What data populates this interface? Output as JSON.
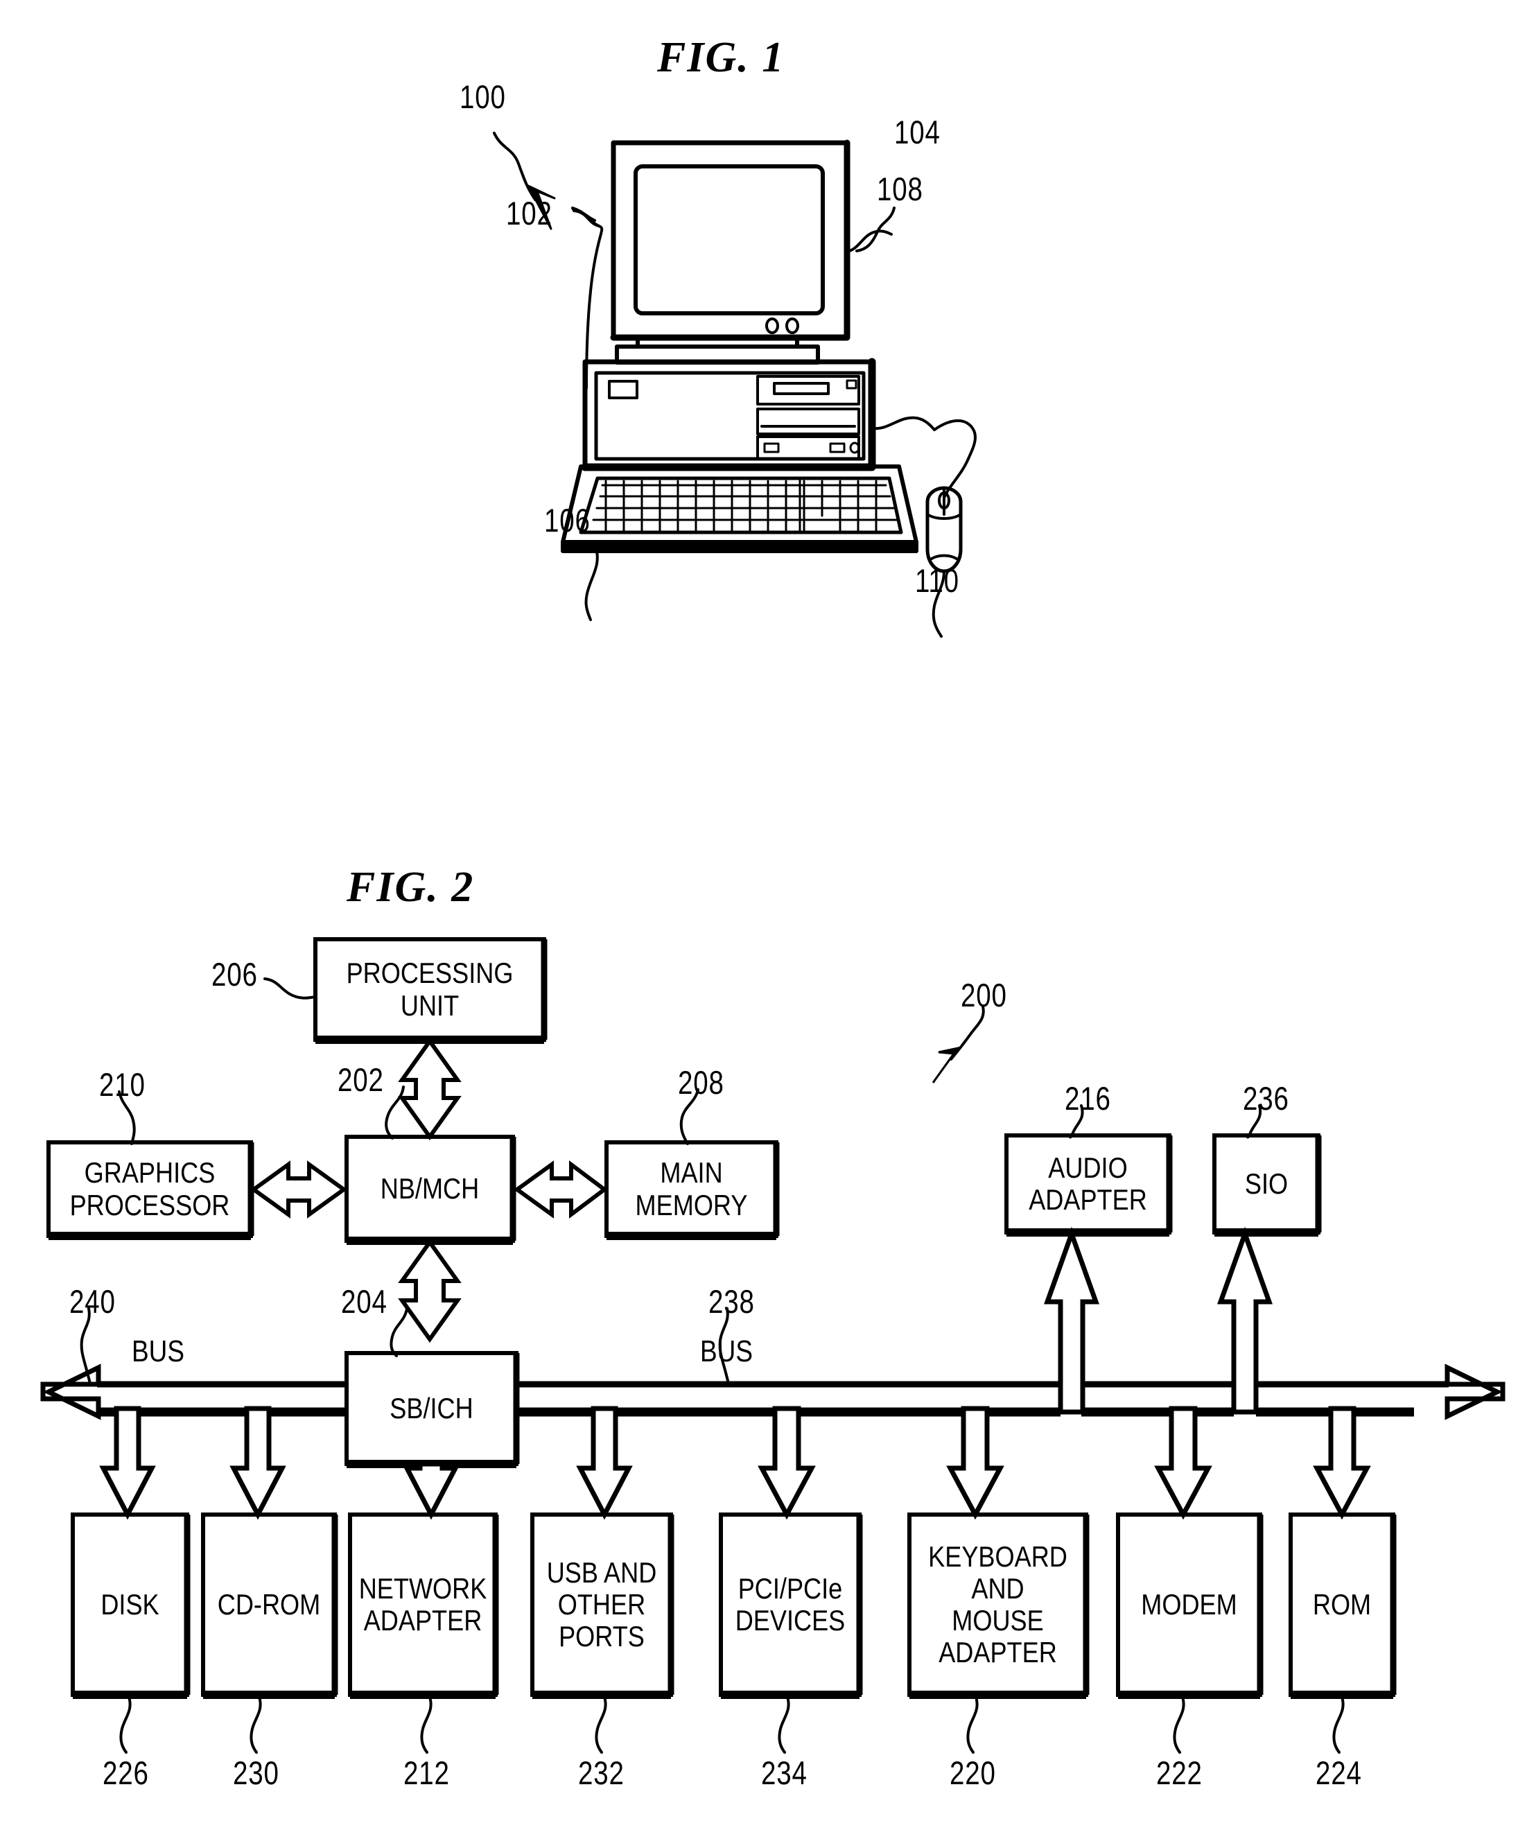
{
  "figures": [
    {
      "id": "fig1",
      "title": "FIG. 1",
      "ref_main": "100",
      "callouts": [
        {
          "id": "monitor",
          "num": "104",
          "label": "display monitor"
        },
        {
          "id": "unit",
          "num": "102",
          "label": "system unit"
        },
        {
          "id": "media",
          "num": "108",
          "label": "drive bay"
        },
        {
          "id": "keyboard",
          "num": "106",
          "label": "keyboard"
        },
        {
          "id": "mouse",
          "num": "110",
          "label": "mouse"
        }
      ]
    },
    {
      "id": "fig2",
      "title": "FIG. 2",
      "ref_main": "200",
      "bus_labels": [
        "BUS",
        "BUS"
      ],
      "bus_refs": [
        "240",
        "238"
      ],
      "blocks": [
        {
          "id": "processing-unit",
          "text": "PROCESSING\nUNIT",
          "num": "206"
        },
        {
          "id": "nb-mch",
          "text": "NB/MCH",
          "num": "202"
        },
        {
          "id": "graphics-processor",
          "text": "GRAPHICS\nPROCESSOR",
          "num": "210"
        },
        {
          "id": "main-memory",
          "text": "MAIN\nMEMORY",
          "num": "208"
        },
        {
          "id": "sb-ich",
          "text": "SB/ICH",
          "num": "204"
        },
        {
          "id": "audio-adapter",
          "text": "AUDIO\nADAPTER",
          "num": "216"
        },
        {
          "id": "sio",
          "text": "SIO",
          "num": "236"
        },
        {
          "id": "disk",
          "text": "DISK",
          "num": "226"
        },
        {
          "id": "cd-rom",
          "text": "CD-ROM",
          "num": "230"
        },
        {
          "id": "network-adapter",
          "text": "NETWORK\nADAPTER",
          "num": "212"
        },
        {
          "id": "usb-ports",
          "text": "USB AND\nOTHER\nPORTS",
          "num": "232"
        },
        {
          "id": "pci-devices",
          "text": "PCI/PCIe\nDEVICES",
          "num": "234"
        },
        {
          "id": "keyboard-mouse",
          "text": "KEYBOARD\nAND\nMOUSE\nADAPTER",
          "num": "220"
        },
        {
          "id": "modem",
          "text": "MODEM",
          "num": "222"
        },
        {
          "id": "rom",
          "text": "ROM",
          "num": "224"
        }
      ]
    }
  ]
}
